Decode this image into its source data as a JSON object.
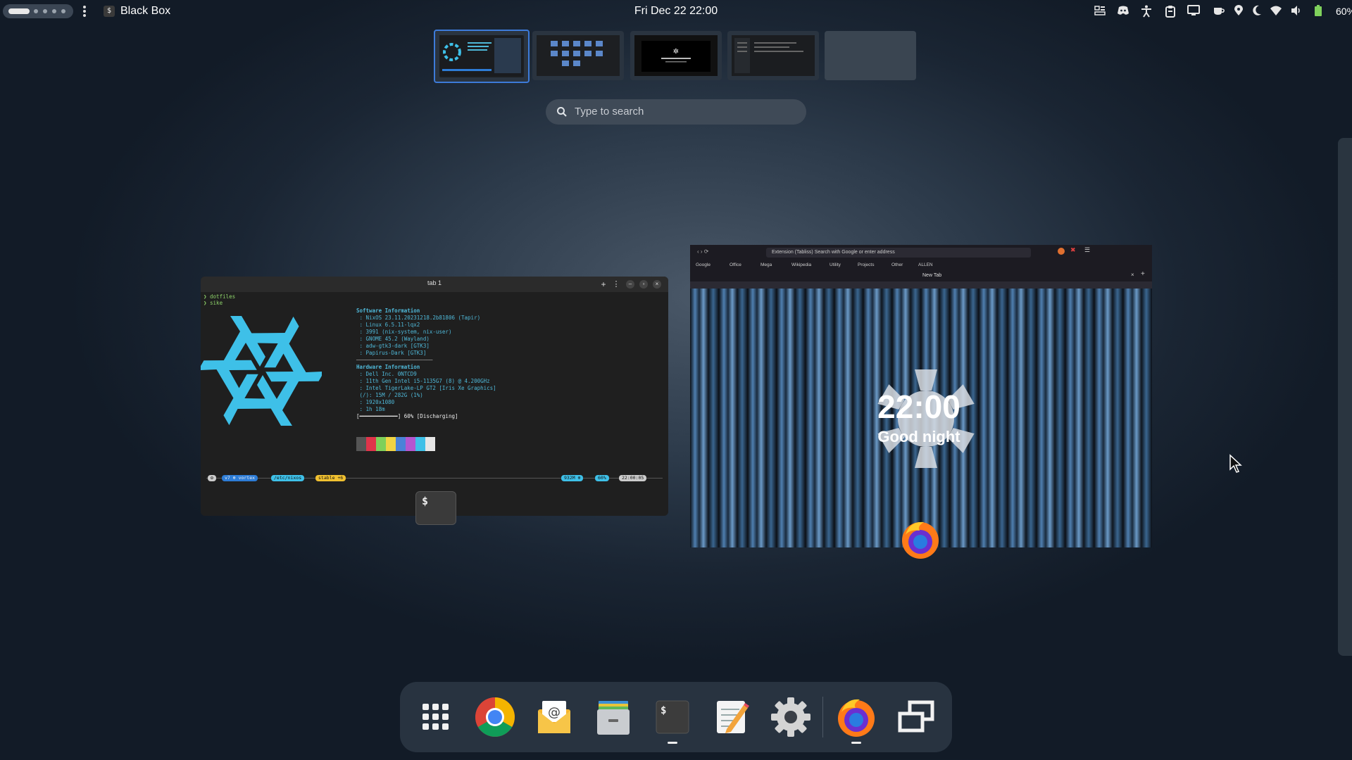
{
  "topbar": {
    "app_name": "Black Box",
    "clock": "Fri Dec 22  22:00",
    "battery_percent": "60%",
    "tray_icons": [
      "grid-icon",
      "discord-icon",
      "accessibility-icon",
      "clipboard-icon",
      "display-icon",
      "coffee-icon",
      "location-icon",
      "night-light-icon",
      "wifi-icon",
      "volume-icon",
      "battery-icon"
    ]
  },
  "workspaces": {
    "count": 5,
    "active_index": 0
  },
  "search": {
    "placeholder": "Type to search"
  },
  "terminal_window": {
    "tab_title": "tab 1",
    "prompt_lines": [
      "dotfiles",
      "sike"
    ],
    "info_lines": [
      "Software Information",
      " : NixOS 23.11.20231218.2b81806 (Tapir)",
      " : Linux 6.5.11-lqx2",
      " : 3991 (nix-system, nix-user)",
      " : GNOME 45.2 (Wayland)",
      " : adw-gtk3-dark [GTK3]",
      " : Papirus-Dark [GTK3]",
      "────────────────────────",
      "Hardware Information",
      " : Dell Inc. 0NTCD9",
      " : 11th Gen Intel i5-1135G7 (8) @ 4.200GHz",
      " : Intel TigerLake-LP GT2 [Iris Xe Graphics]",
      " (/): 15M / 282G (1%)",
      " : 1920x1080",
      " : 1h 18m",
      "[━━━━━━━━━━━━] 60% [Discharging]"
    ],
    "statusline": {
      "user": "v7 ⊕ vortex",
      "path": "/etc/nixos",
      "branch": "stable +6",
      "mem": "932M ⊕",
      "battery": "60%",
      "time": "22:00:05"
    }
  },
  "browser_window": {
    "url_bar": "Extension (Tabliss)   Search with Google or enter address",
    "bookmarks": [
      "Google",
      "Office",
      "Mega",
      "Wikipedia",
      "Utility",
      "Projects",
      "Other",
      "ALLEN"
    ],
    "tab_title": "New Tab",
    "newtab_time": "22:00",
    "newtab_greeting": "Good night"
  },
  "dock": {
    "items": [
      {
        "name": "app-grid",
        "label": "Show Apps"
      },
      {
        "name": "chrome",
        "label": "Google Chrome"
      },
      {
        "name": "mail",
        "label": "Mail"
      },
      {
        "name": "files",
        "label": "Files"
      },
      {
        "name": "terminal",
        "label": "Black Box"
      },
      {
        "name": "text-editor",
        "label": "Text Editor"
      },
      {
        "name": "settings",
        "label": "Settings"
      },
      {
        "name": "firefox",
        "label": "Firefox"
      },
      {
        "name": "workspaces",
        "label": "Workspaces"
      }
    ]
  },
  "colors": {
    "accent": "#3d7bd9",
    "terminal_cyan": "#4fb8d8",
    "prompt_green": "#8ed36a"
  }
}
